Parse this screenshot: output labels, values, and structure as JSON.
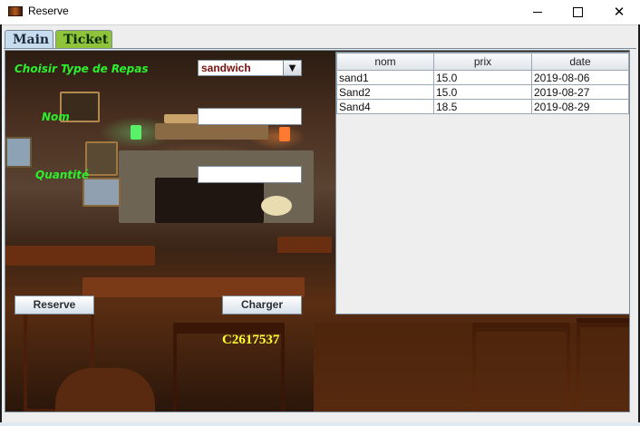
{
  "window": {
    "title": "Reserve"
  },
  "tabs": [
    {
      "label": "Main"
    },
    {
      "label": "Ticket"
    }
  ],
  "form": {
    "meal_type_label": "Choisir Type de Repas",
    "meal_type_value": "sandwich",
    "name_label": "Nom",
    "name_value": "",
    "quantity_label": "Quantité",
    "quantity_value": "",
    "reserve_button": "Reserve",
    "load_button": "Charger",
    "code": "C2617537"
  },
  "table": {
    "columns": [
      "nom",
      "prix",
      "date"
    ],
    "rows": [
      [
        "sand1",
        "15.0",
        "2019-08-06"
      ],
      [
        "Sand2",
        "15.0",
        "2019-08-27"
      ],
      [
        "Sand4",
        "18.5",
        "2019-08-29"
      ]
    ]
  },
  "colors": {
    "label_green": "#2cf02c",
    "code_yellow": "#ffff33",
    "ticket_tab": "#8fc43a",
    "main_tab": "#c8dcf0"
  }
}
